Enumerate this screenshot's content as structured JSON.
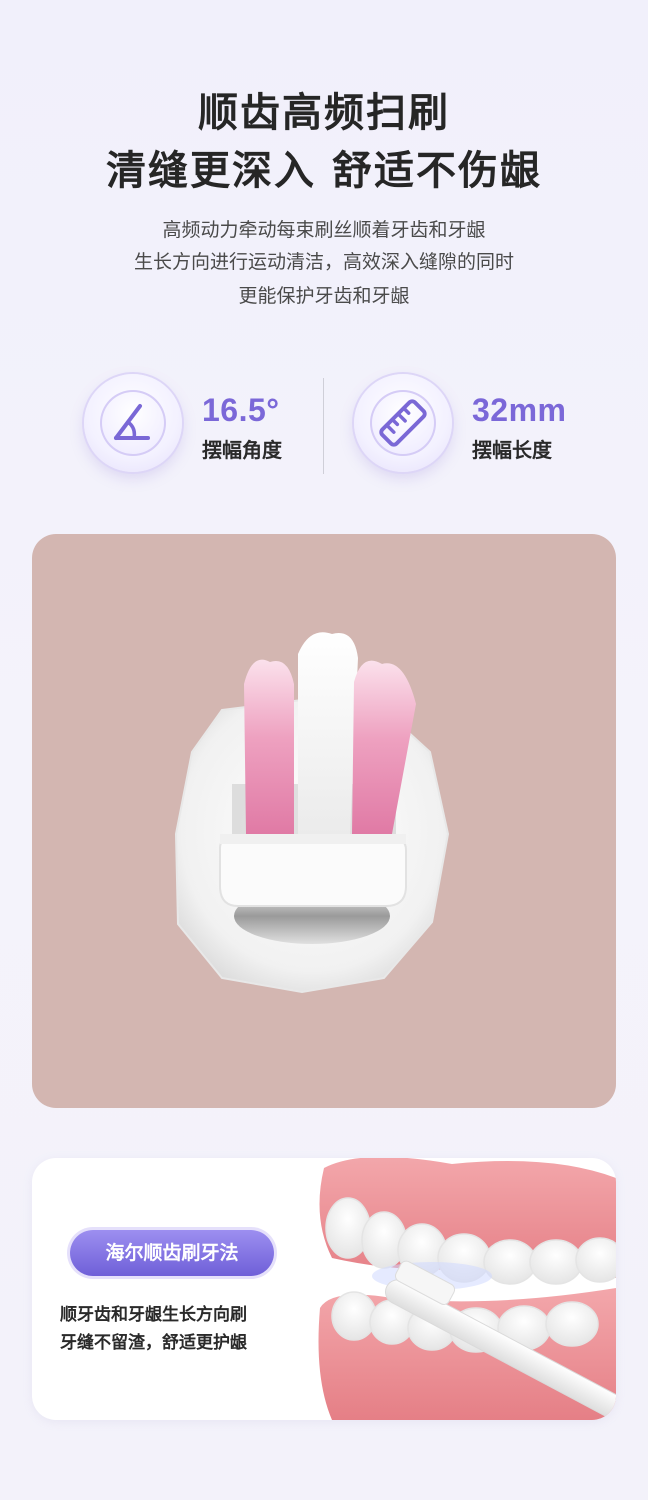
{
  "heading": {
    "line1": "顺齿高频扫刷",
    "line2": "清缝更深入 舒适不伤龈"
  },
  "description": {
    "line1": "高频动力牵动每束刷丝顺着牙齿和牙龈",
    "line2": "生长方向进行运动清洁，高效深入缝隙的同时",
    "line3": "更能保护牙齿和牙龈"
  },
  "specs": [
    {
      "icon": "angle-icon",
      "value": "16.5°",
      "label": "摆幅角度"
    },
    {
      "icon": "ruler-icon",
      "value": "32mm",
      "label": "摆幅长度"
    }
  ],
  "method": {
    "badge_label": "海尔顺齿刷牙法",
    "text_line1": "顺牙齿和牙龈生长方向刷",
    "text_line2": "牙缝不留渣，舒适更护龈"
  },
  "colors": {
    "accent": "#7b68d8",
    "photo_background": "#d3b6b1",
    "bristle_pink": "#e89ab8",
    "gum_pink": "#e98c92"
  }
}
